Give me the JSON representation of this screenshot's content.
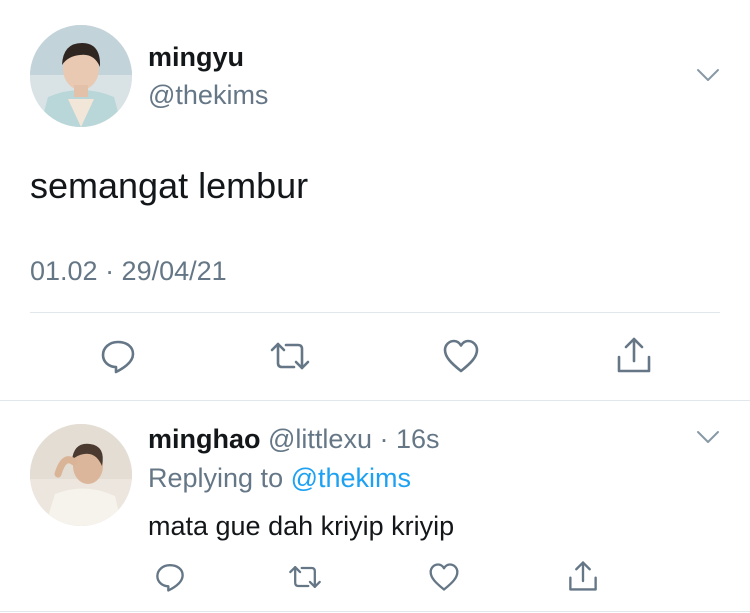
{
  "main_tweet": {
    "display_name": "mingyu",
    "handle": "@thekims",
    "text": "semangat lembur",
    "timestamp": "01.02 · 29/04/21"
  },
  "reply": {
    "display_name": "minghao",
    "handle": "@littlexu",
    "separator": " · ",
    "time": "16s",
    "replying_prefix": "Replying to ",
    "replying_mention": "@thekims",
    "text": "mata gue dah kriyip kriyip"
  },
  "icons": {
    "reply": "speech-bubble-icon",
    "retweet": "retweet-icon",
    "like": "heart-icon",
    "share": "share-icon",
    "more": "chevron-down-icon"
  },
  "colors": {
    "text": "#14171a",
    "secondary": "#657786",
    "link": "#1da1f2",
    "divider": "#e1e8ed"
  }
}
